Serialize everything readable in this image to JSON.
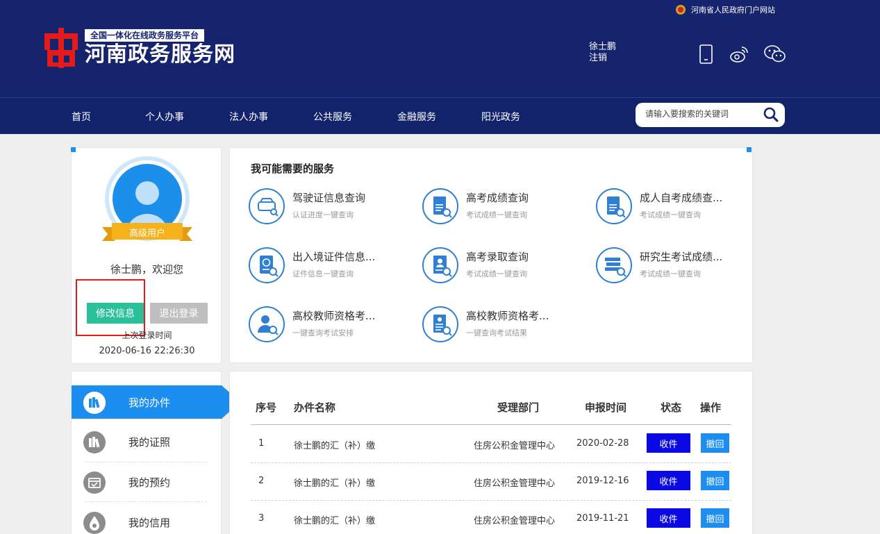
{
  "header": {
    "gov_link": "河南省人民政府门户网站",
    "logo_sub": "全国一体化在线政务服务平台",
    "logo_main": "河南政务服务网",
    "user_name": "徐士鹏",
    "logout": "注销"
  },
  "nav": {
    "items": [
      "首页",
      "个人办事",
      "法人办事",
      "公共服务",
      "金融服务",
      "阳光政务"
    ],
    "search_placeholder": "请输入要搜索的关键词"
  },
  "profile": {
    "level": "高级用户",
    "welcome": "徐士鹏，欢迎您",
    "edit_button": "修改信息",
    "logout_button": "退出登录",
    "last_login_label": "上次登录时间",
    "last_login_time": "2020-06-16 22:26:30"
  },
  "menu": {
    "items": [
      "我的办件",
      "我的证照",
      "我的预约",
      "我的信用"
    ],
    "active": "我的办件"
  },
  "services": {
    "title": "我可能需要的服务",
    "items": [
      {
        "name": "驾驶证信息查询",
        "desc": "认证进度一键查询",
        "icon": "car-search-icon"
      },
      {
        "name": "高考成绩查询",
        "desc": "考试成绩一键查询",
        "icon": "document-search-icon"
      },
      {
        "name": "成人自考成绩查...",
        "desc": "考试成绩一键查询",
        "icon": "document-search-icon"
      },
      {
        "name": "出入境证件信息...",
        "desc": "证件信息一键查询",
        "icon": "passport-search-icon"
      },
      {
        "name": "高考录取查询",
        "desc": "考试成绩一键查询",
        "icon": "admission-search-icon"
      },
      {
        "name": "研究生考试成绩...",
        "desc": "考试成绩一键查询",
        "icon": "books-search-icon"
      },
      {
        "name": "高校教师资格考...",
        "desc": "一键查询考试安排",
        "icon": "teacher-search-icon"
      },
      {
        "name": "高校教师资格考...",
        "desc": "一键查询考试结果",
        "icon": "document-search-icon"
      }
    ]
  },
  "table": {
    "headers": [
      "序号",
      "办件名称",
      "受理部门",
      "申报时间",
      "状态",
      "操作"
    ],
    "rows": [
      {
        "no": "1",
        "name": "徐士鹏的汇（补）缴",
        "dept": "住房公积金管理中心",
        "date": "2020-02-28",
        "status": "收件",
        "action": "撤回"
      },
      {
        "no": "2",
        "name": "徐士鹏的汇（补）缴",
        "dept": "住房公积金管理中心",
        "date": "2019-12-16",
        "status": "收件",
        "action": "撤回"
      },
      {
        "no": "3",
        "name": "徐士鹏的汇（补）缴",
        "dept": "住房公积金管理中心",
        "date": "2019-11-21",
        "status": "收件",
        "action": "撤回"
      }
    ]
  },
  "colors": {
    "header_bg": "#15246c",
    "accent_blue": "#1b8ef0",
    "edit_green": "#2ac09a",
    "status_blue": "#0a09e3",
    "highlight_red": "#e01b1b"
  }
}
